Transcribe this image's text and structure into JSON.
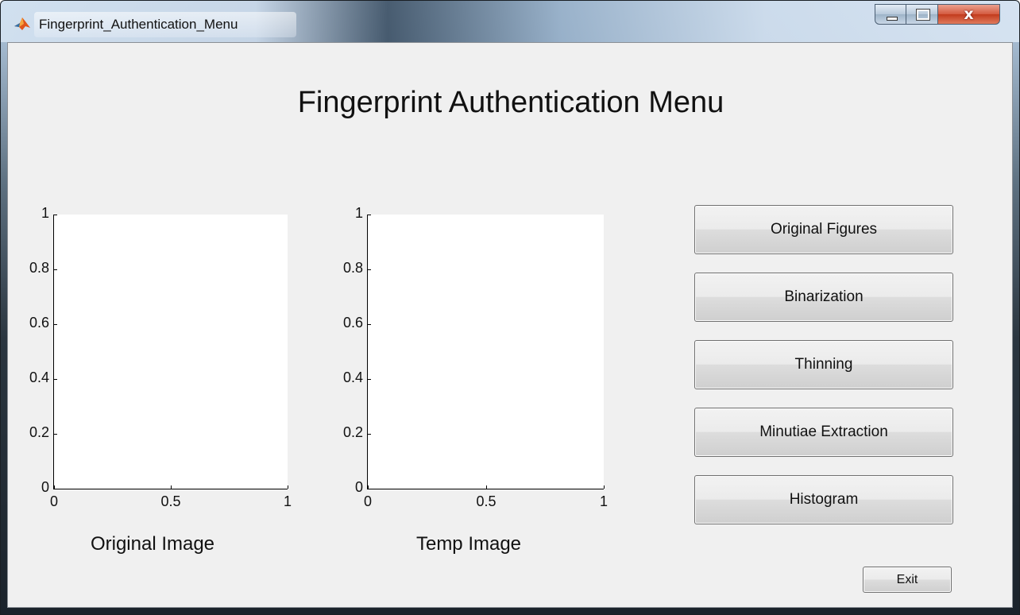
{
  "window": {
    "title": "Fingerprint_Authentication_Menu",
    "close_glyph": "x"
  },
  "main": {
    "title": "Fingerprint Authentication Menu"
  },
  "axes": [
    {
      "caption": "Original Image",
      "xticks": [
        "0",
        "0.5",
        "1"
      ],
      "yticks": [
        "0",
        "0.2",
        "0.4",
        "0.6",
        "0.8",
        "1"
      ]
    },
    {
      "caption": "Temp Image",
      "xticks": [
        "0",
        "0.5",
        "1"
      ],
      "yticks": [
        "0",
        "0.2",
        "0.4",
        "0.6",
        "0.8",
        "1"
      ]
    }
  ],
  "buttons": [
    {
      "label": "Original Figures"
    },
    {
      "label": "Binarization"
    },
    {
      "label": "Thinning"
    },
    {
      "label": "Minutiae Extraction"
    },
    {
      "label": "Histogram"
    }
  ],
  "exit_label": "Exit",
  "colors": {
    "client_bg": "#f0f0f0",
    "plot_bg": "#ffffff",
    "close_button": "#c23b1d"
  },
  "icons": {
    "app": "matlab-icon",
    "minimize": "minimize-icon",
    "maximize": "maximize-icon",
    "close": "close-icon"
  }
}
